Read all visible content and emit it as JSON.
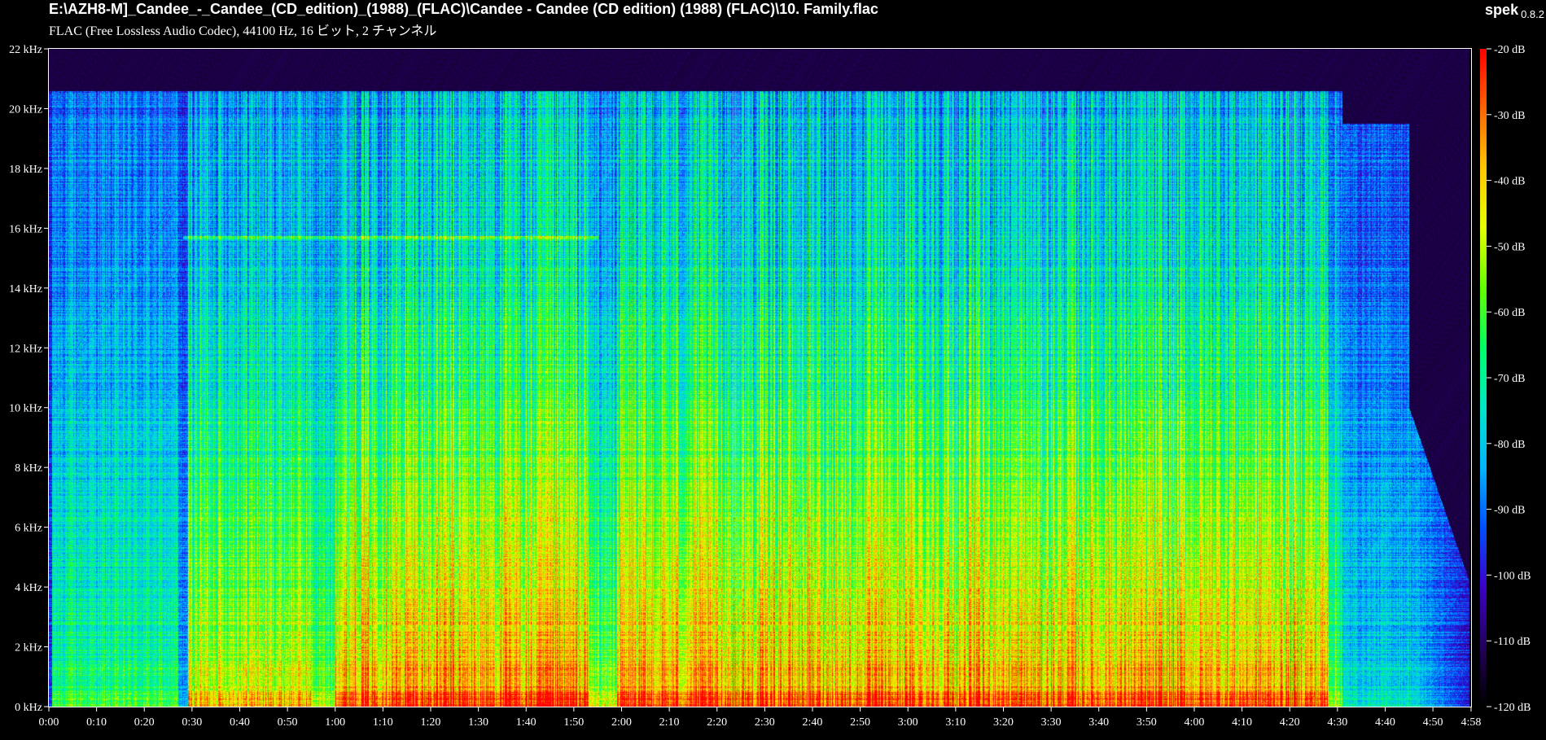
{
  "window": {
    "title": "E:\\AZH8-M]_Candee_-_Candee_(CD_edition)_(1988)_(FLAC)\\Candee - Candee (CD edition) (1988) (FLAC)\\10. Family.flac",
    "subtitle": "FLAC (Free Lossless Audio Codec), 44100 Hz, 16 ビット, 2 チャンネル",
    "brand": "spek",
    "version": "0.8.2"
  },
  "spectrogram": {
    "duration_s": 298,
    "max_freq_khz": 22,
    "freq_ticks": [
      "0 kHz",
      "2 kHz",
      "4 kHz",
      "6 kHz",
      "8 kHz",
      "10 kHz",
      "12 kHz",
      "14 kHz",
      "16 kHz",
      "18 kHz",
      "20 kHz",
      "22 kHz"
    ],
    "time_ticks": [
      "0:00",
      "0:10",
      "0:20",
      "0:30",
      "0:40",
      "0:50",
      "1:00",
      "1:10",
      "1:20",
      "1:30",
      "1:40",
      "1:50",
      "2:00",
      "2:10",
      "2:20",
      "2:30",
      "2:40",
      "2:50",
      "3:00",
      "3:10",
      "3:20",
      "3:30",
      "3:40",
      "3:50",
      "4:00",
      "4:10",
      "4:20",
      "4:30",
      "4:40",
      "4:50",
      "4:58"
    ],
    "time_tick_seconds": [
      0,
      10,
      20,
      30,
      40,
      50,
      60,
      70,
      80,
      90,
      100,
      110,
      120,
      130,
      140,
      150,
      160,
      170,
      180,
      190,
      200,
      210,
      220,
      230,
      240,
      250,
      260,
      270,
      280,
      290,
      298
    ],
    "db_ticks": [
      "-20 dB",
      "-30 dB",
      "-40 dB",
      "-50 dB",
      "-60 dB",
      "-70 dB",
      "-80 dB",
      "-90 dB",
      "-100 dB",
      "-110 dB",
      "-120 dB"
    ],
    "db_range": [
      -120,
      -20
    ],
    "colormap": [
      "#000000",
      "#23005a",
      "#3c00c8",
      "#0050ff",
      "#00b4ff",
      "#00e6c8",
      "#00ff64",
      "#64ff00",
      "#e6ff00",
      "#ffc800",
      "#ff6400",
      "#ff0000"
    ],
    "axis_color": "#ffffff",
    "background": "#000000"
  }
}
